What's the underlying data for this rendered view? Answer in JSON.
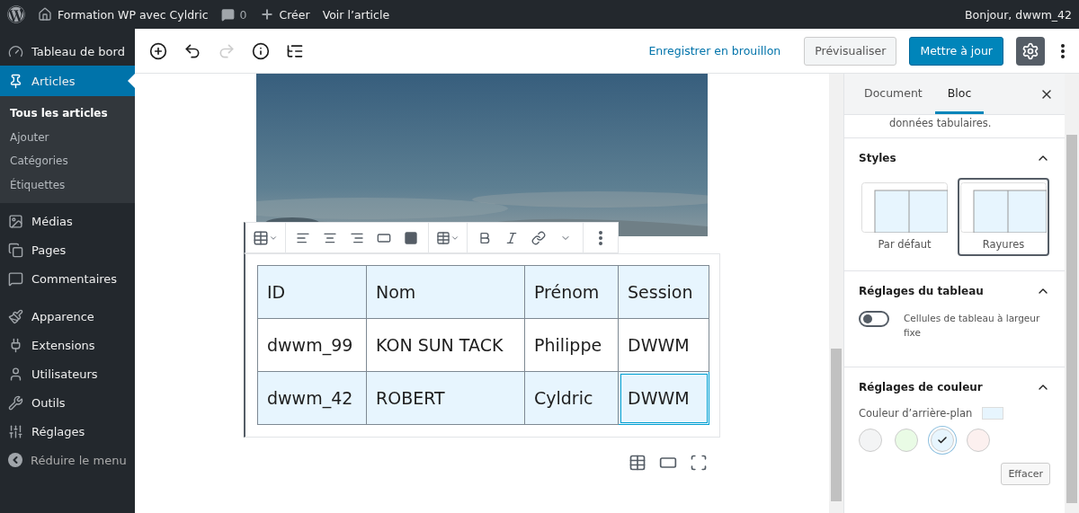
{
  "admin_bar": {
    "site_title": "Formation WP avec Cyldric",
    "comments_count": "0",
    "new_label": "Créer",
    "view_label": "Voir l’article",
    "greeting": "Bonjour, dwwm_42"
  },
  "sidebar": {
    "items": [
      {
        "label": "Tableau de bord",
        "selected": false
      },
      {
        "label": "Articles",
        "selected": true,
        "children": [
          {
            "label": "Tous les articles",
            "selected": true
          },
          {
            "label": "Ajouter",
            "selected": false
          },
          {
            "label": "Catégories",
            "selected": false
          },
          {
            "label": "Étiquettes",
            "selected": false
          }
        ]
      },
      {
        "label": "Médias",
        "selected": false
      },
      {
        "label": "Pages",
        "selected": false
      },
      {
        "label": "Commentaires",
        "selected": false
      },
      {
        "label": "Apparence",
        "selected": false
      },
      {
        "label": "Extensions",
        "selected": false
      },
      {
        "label": "Utilisateurs",
        "selected": false
      },
      {
        "label": "Outils",
        "selected": false
      },
      {
        "label": "Réglages",
        "selected": false
      },
      {
        "label": "Réduire le menu",
        "selected": false,
        "kind": "collapse"
      }
    ]
  },
  "editor_header": {
    "redo_disabled": true,
    "save_draft": "Enregistrer en brouillon",
    "preview": "Prévisualiser",
    "update": "Mettre à jour",
    "settings_open": true
  },
  "editor": {
    "table": {
      "rows": [
        {
          "shaded": true,
          "cells": [
            {
              "text": "ID",
              "selected": false
            },
            {
              "text": "Nom",
              "selected": false
            },
            {
              "text": "Prénom",
              "selected": false
            },
            {
              "text": "Session",
              "selected": false
            }
          ]
        },
        {
          "shaded": false,
          "cells": [
            {
              "text": "dwwm_99",
              "selected": false
            },
            {
              "text": "KON SUN TACK",
              "selected": false
            },
            {
              "text": "Philippe",
              "selected": false
            },
            {
              "text": "DWWM",
              "selected": false
            }
          ]
        },
        {
          "shaded": true,
          "cells": [
            {
              "text": "dwwm_42",
              "selected": false
            },
            {
              "text": "ROBERT",
              "selected": false
            },
            {
              "text": "Cyldric",
              "selected": false
            },
            {
              "text": "DWWM",
              "selected": true
            }
          ]
        }
      ]
    }
  },
  "settings_panel": {
    "tabs": [
      {
        "label": "Document",
        "selected": false
      },
      {
        "label": "Bloc",
        "selected": true
      }
    ],
    "description": "données tabulaires.",
    "styles": {
      "title": "Styles",
      "expanded": true,
      "options": [
        {
          "label": "Par défaut",
          "selected": false
        },
        {
          "label": "Rayures",
          "selected": true
        }
      ]
    },
    "table_settings": {
      "title": "Réglages du tableau",
      "expanded": true,
      "toggle": {
        "label": "Cellules de tableau à largeur fixe",
        "on": false
      }
    },
    "color_settings": {
      "title": "Réglages de couleur",
      "expanded": true,
      "background_label": "Couleur d’arrière-plan",
      "current_swatch": {
        "color": "#e7f5fe"
      },
      "swatches": [
        {
          "color": "#f3f4f5",
          "selected": false
        },
        {
          "color": "#e9fbe5",
          "selected": false
        },
        {
          "color": "#e7f5fe",
          "selected": true
        },
        {
          "color": "#fcf0ef",
          "selected": false
        }
      ],
      "clear_button": "Effacer"
    }
  }
}
